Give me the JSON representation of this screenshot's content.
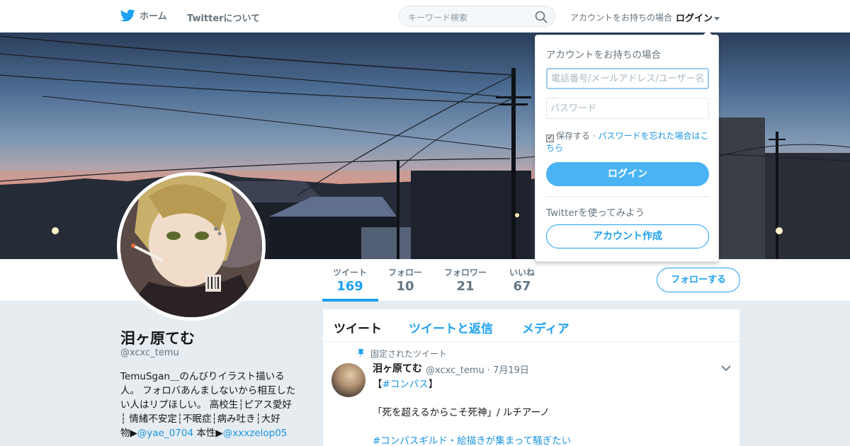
{
  "nav": {
    "home_label": "ホーム",
    "about_label": "Twitterについて",
    "search_placeholder": "キーワード検索",
    "have_account": "アカウントをお持ちの場合",
    "login_label": "ログイン"
  },
  "profile": {
    "name": "泪ヶ原てむ",
    "handle": "@xcxc_temu",
    "bio_lines": [
      "TemuSgan＿のんびりイラスト描いる",
      "人。 フォロバあんましないから相互した",
      "い人はリプほしい。 高校生┆ピアス愛好",
      "┆ 情緒不安定┆不眠症┆病み吐き┆大好"
    ],
    "bio_last_prefix": "物▶",
    "bio_link1": "@yae_0704",
    "bio_mid": " 本性▶",
    "bio_link2": "@xxxzelop05",
    "follow_button": "フォローする"
  },
  "stats": [
    {
      "label": "ツイート",
      "value": "169"
    },
    {
      "label": "フォロー",
      "value": "10"
    },
    {
      "label": "フォロワー",
      "value": "21"
    },
    {
      "label": "いいね",
      "value": "67"
    }
  ],
  "timeline": {
    "tabs": [
      "ツイート",
      "ツイートと返信",
      "メディア"
    ],
    "pinned_label": "固定されたツイート",
    "tweet": {
      "name": "泪ヶ原てむ",
      "meta": "@xcxc_temu · 7月19日",
      "line1_open": "【",
      "line1_tag": "#コンパス",
      "line1_close": "】",
      "line2": "「死を超えるからこそ死神」/ ルチアーノ",
      "line3": "#コンパスギルド・絵描きが集まって騒ぎたい"
    }
  },
  "login_dropdown": {
    "title": "アカウントをお持ちの場合",
    "username_placeholder": "電話番号/メールアドレス/ユーザー名",
    "password_placeholder": "パスワード",
    "remember": "保存する",
    "forgot": "パスワードを忘れた場合はこちら",
    "login_button": "ログイン",
    "try_label": "Twitterを使ってみよう",
    "signup_button": "アカウント作成"
  },
  "colors": {
    "accent": "#1da1f2",
    "link": "#1b95e0",
    "background": "#e6ecf0"
  }
}
